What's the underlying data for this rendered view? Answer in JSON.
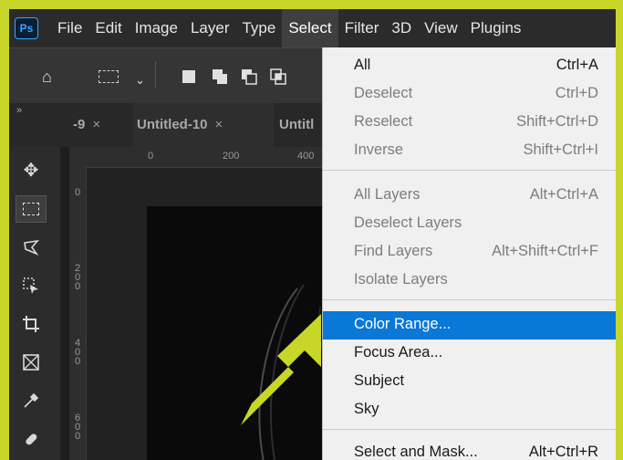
{
  "app": {
    "logo": "Ps"
  },
  "menubar": {
    "items": [
      "File",
      "Edit",
      "Image",
      "Layer",
      "Type",
      "Select",
      "Filter",
      "3D",
      "View",
      "Plugins"
    ]
  },
  "tabs": [
    {
      "label": "-9",
      "close": "×"
    },
    {
      "label": "Untitled-10",
      "close": "×"
    },
    {
      "label": "Untitl",
      "close": ""
    }
  ],
  "ruler": {
    "h": [
      "0",
      "200",
      "400"
    ],
    "v": [
      "0",
      "2\n0\n0",
      "4\n0\n0",
      "6\n0\n0"
    ]
  },
  "select_menu": {
    "group1": [
      {
        "label": "All",
        "shortcut": "Ctrl+A",
        "enabled": true
      },
      {
        "label": "Deselect",
        "shortcut": "Ctrl+D",
        "enabled": false
      },
      {
        "label": "Reselect",
        "shortcut": "Shift+Ctrl+D",
        "enabled": false
      },
      {
        "label": "Inverse",
        "shortcut": "Shift+Ctrl+I",
        "enabled": false
      }
    ],
    "group2": [
      {
        "label": "All Layers",
        "shortcut": "Alt+Ctrl+A",
        "enabled": false
      },
      {
        "label": "Deselect Layers",
        "shortcut": "",
        "enabled": false
      },
      {
        "label": "Find Layers",
        "shortcut": "Alt+Shift+Ctrl+F",
        "enabled": false
      },
      {
        "label": "Isolate Layers",
        "shortcut": "",
        "enabled": false
      }
    ],
    "group3": [
      {
        "label": "Color Range...",
        "shortcut": "",
        "enabled": true,
        "highlighted": true
      },
      {
        "label": "Focus Area...",
        "shortcut": "",
        "enabled": true
      },
      {
        "label": "Subject",
        "shortcut": "",
        "enabled": true
      },
      {
        "label": "Sky",
        "shortcut": "",
        "enabled": true
      }
    ],
    "group4": [
      {
        "label": "Select and Mask...",
        "shortcut": "Alt+Ctrl+R",
        "enabled": true
      }
    ]
  },
  "colors": {
    "accent_frame": "#c8d62a",
    "highlight": "#0a78d7",
    "ps_blue": "#31a8ff"
  }
}
